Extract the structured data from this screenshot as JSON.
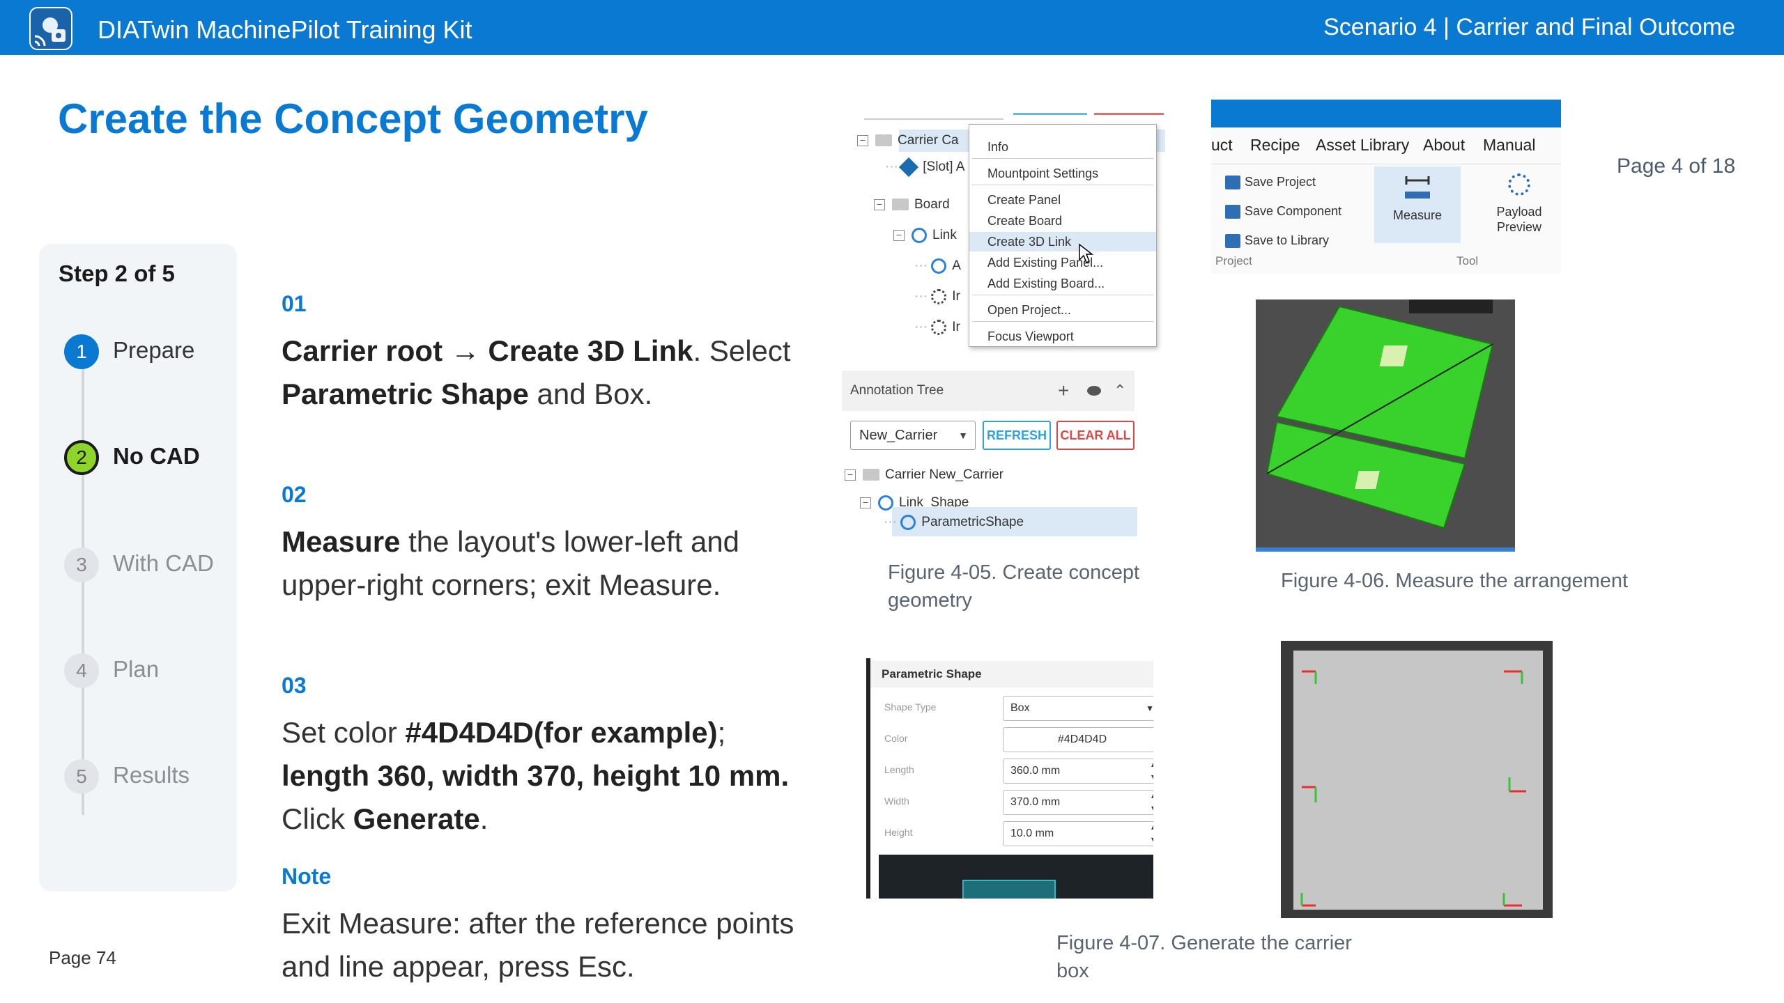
{
  "header": {
    "app_title": "DIATwin MachinePilot Training Kit",
    "scenario": "Scenario 4 | Carrier and Final Outcome"
  },
  "page_title": "Create the Concept Geometry",
  "page_of": "Page 4 of 18",
  "page_footer": "Page 74",
  "stepper": {
    "heading": "Step 2 of 5",
    "steps": [
      {
        "num": "1",
        "label": "Prepare"
      },
      {
        "num": "2",
        "label": "No CAD"
      },
      {
        "num": "3",
        "label": "With CAD"
      },
      {
        "num": "4",
        "label": "Plan"
      },
      {
        "num": "5",
        "label": "Results"
      }
    ]
  },
  "instructions": {
    "s1": {
      "num": "01",
      "a": "Carrier root → Create 3D Link",
      "b": ". Select ",
      "c": "Parametric Shape",
      "d": " and Box."
    },
    "s2": {
      "num": "02",
      "a": "Measure",
      "b": " the layout's lower-left and upper-right corners; exit Measure."
    },
    "s3": {
      "num": "03",
      "a": "Set color ",
      "b": "#4D4D4D(for example)",
      "c": "; ",
      "d": "length 360, width 370, height 10 mm.",
      "e": " Click ",
      "f": "Generate",
      "g": "."
    },
    "note": {
      "label": "Note",
      "text": "Exit Measure: after the reference points and line appear, press Esc."
    }
  },
  "figure1": {
    "tree": {
      "carrier": "Carrier  Ca",
      "slot": "[Slot] A",
      "board": "Board",
      "link": "Link",
      "a": "A",
      "i1": "Ir",
      "i2": "Ir"
    },
    "context_menu": [
      "Info",
      "Mountpoint Settings",
      "Create Panel",
      "Create Board",
      "Create 3D Link",
      "Add Existing Panel...",
      "Add Existing Board...",
      "Open Project...",
      "Focus Viewport"
    ],
    "annotation_tree": {
      "title": "Annotation Tree",
      "select": "New_Carrier",
      "refresh": "REFRESH",
      "clear": "CLEAR ALL",
      "rows": [
        "Carrier  New_Carrier",
        "Link_Shape",
        "ParametricShape"
      ]
    },
    "caption": "Figure 4-05. Create concept geometry"
  },
  "figure2": {
    "menu": [
      "uct",
      "Recipe",
      "Asset Library",
      "About",
      "Manual"
    ],
    "project_items": [
      "Save Project",
      "Save Component",
      "Save to Library"
    ],
    "measure": "Measure",
    "payload": "Payload Preview",
    "group_project": "Project",
    "group_tool": "Tool",
    "caption": "Figure 4-06. Measure the arrangement"
  },
  "figure3": {
    "panel_title": "Parametric Shape",
    "fields": [
      {
        "key": "Shape Type",
        "value": "Box"
      },
      {
        "key": "Color",
        "value": "#4D4D4D"
      },
      {
        "key": "Length",
        "value": "360.0 mm"
      },
      {
        "key": "Width",
        "value": "370.0 mm"
      },
      {
        "key": "Height",
        "value": "10.0 mm"
      }
    ],
    "caption": "Figure 4-07. Generate the carrier box"
  },
  "colors": {
    "accent": "#0a79d2",
    "active_step": "#8fd42a",
    "pcb": "#39d12c",
    "carrier": "#4D4D4D"
  }
}
